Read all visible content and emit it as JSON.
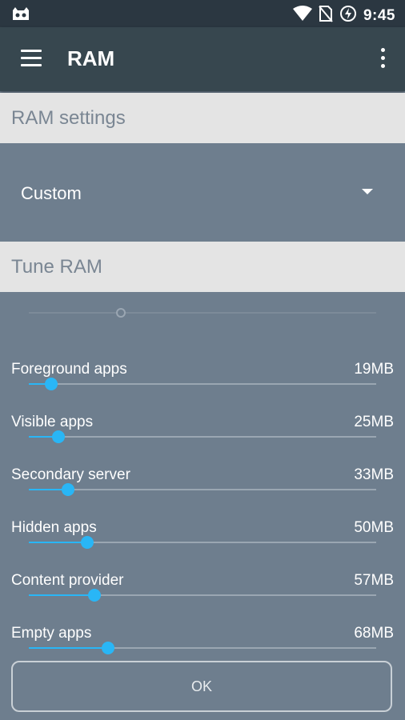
{
  "status_bar": {
    "time": "9:45"
  },
  "app_bar": {
    "title": "RAM"
  },
  "ram_settings": {
    "header": "RAM settings",
    "selected_value": "Custom"
  },
  "tune_ram": {
    "header": "Tune RAM",
    "preset_level": 0.25
  },
  "sliders": [
    {
      "label": "Foreground apps",
      "value": "19MB",
      "fraction": 0.065
    },
    {
      "label": "Visible apps",
      "value": "25MB",
      "fraction": 0.085
    },
    {
      "label": "Secondary server",
      "value": "33MB",
      "fraction": 0.112
    },
    {
      "label": "Hidden apps",
      "value": "50MB",
      "fraction": 0.168
    },
    {
      "label": "Content provider",
      "value": "57MB",
      "fraction": 0.19
    },
    {
      "label": "Empty apps",
      "value": "68MB",
      "fraction": 0.228
    }
  ],
  "dialog": {
    "ok_label": "OK"
  },
  "colors": {
    "accent": "#29b6f6",
    "app_bar": "#37474f",
    "status_bar": "#2b3741",
    "background": "#6e7e8e",
    "section_header": "#e4e4e4"
  }
}
